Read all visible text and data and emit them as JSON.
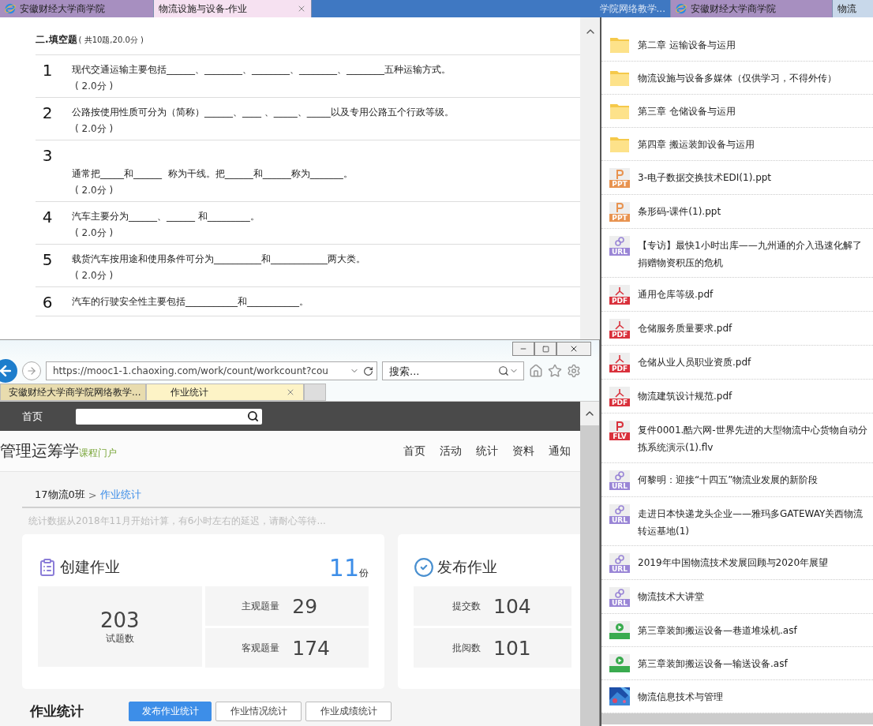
{
  "taskbar": {
    "tabs": [
      {
        "label": "安徽财经大学商学院",
        "selected": false,
        "kind": "ie"
      },
      {
        "label": "物流设施与设备-作业",
        "selected": true,
        "kind": "plain"
      },
      {
        "label": "学院网络教学...",
        "selected": false,
        "kind": "blurred"
      },
      {
        "label": "安徽财经大学商学院",
        "selected": false,
        "kind": "ie"
      },
      {
        "label": "物流",
        "selected": false,
        "kind": "plain"
      }
    ]
  },
  "homework": {
    "section_title": "二.填空题",
    "section_note": "( 共10题,20.0分 )",
    "questions": [
      {
        "number": "1",
        "kind": "inline",
        "text": "现代交通运输主要包括______、________、________、________、________五种运输方式。",
        "score": "( 2.0分 )"
      },
      {
        "number": "2",
        "kind": "inline",
        "text": "公路按使用性质可分为（简称）______、____ 、_____、_____以及专用公路五个行政等级。",
        "score": "( 2.0分 )"
      },
      {
        "number": "3",
        "kind": "block",
        "text": "通常把_____和______  称为干线。把______和______称为_______。",
        "score": "( 2.0分 )"
      },
      {
        "number": "4",
        "kind": "inline",
        "text": "汽车主要分为______、______ 和_________。",
        "score": "( 2.0分 )"
      },
      {
        "number": "5",
        "kind": "inline",
        "text": "载货汽车按用途和使用条件可分为__________和____________两大类。",
        "score": "( 2.0分 )"
      },
      {
        "number": "6",
        "kind": "inline",
        "text": "汽车的行驶安全性主要包括___________和___________。"
      }
    ]
  },
  "browser": {
    "address": "https://mooc1-1.chaoxing.com/work/count/workcount?cou",
    "search": {
      "placeholder": "搜索..."
    },
    "tabs": [
      {
        "label": "安徽财经大学商学院网络教学...",
        "selected": false
      },
      {
        "label": "作业统计",
        "selected": true
      }
    ]
  },
  "site": {
    "top_nav": "首页",
    "course_title": "管理运筹学",
    "course_subtitle": "课程门户",
    "nav": [
      "首页",
      "活动",
      "统计",
      "资料",
      "通知"
    ],
    "breadcrumb": {
      "parent": "17物流0班",
      "separator": ">",
      "current": "作业统计"
    },
    "notice": "统计数据从2018年11月开始计算，有6小时左右的延迟，请耐心等待...",
    "create_card": {
      "title": "创建作业",
      "count": "11",
      "unit": "份",
      "total": {
        "value": "203",
        "label": "试题数"
      },
      "stats": [
        {
          "label": "主观题量",
          "value": "29"
        },
        {
          "label": "客观题量",
          "value": "174"
        }
      ]
    },
    "publish_card": {
      "title": "发布作业",
      "stats": [
        {
          "label": "提交数",
          "value": "104"
        },
        {
          "label": "批阅数",
          "value": "101"
        }
      ]
    },
    "stats_heading": "作业统计",
    "stats_tabs": [
      {
        "label": "发布作业统计",
        "selected": true
      },
      {
        "label": "作业情况统计",
        "selected": false
      },
      {
        "label": "作业成绩统计",
        "selected": false
      }
    ]
  },
  "files": [
    {
      "kind": "folder",
      "name": "第二章 运输设备与运用"
    },
    {
      "kind": "folder",
      "name": "物流设施与设备多媒体（仅供学习，不得外传）"
    },
    {
      "kind": "folder",
      "name": "第三章 仓储设备与运用"
    },
    {
      "kind": "folder",
      "name": "第四章 搬运装卸设备与运用"
    },
    {
      "kind": "ppt",
      "badge": "PPT",
      "name": "3-电子数据交换技术EDI(1).ppt"
    },
    {
      "kind": "ppt",
      "badge": "PPT",
      "name": "条形码-课件(1).ppt"
    },
    {
      "kind": "url",
      "badge": "URL",
      "name": "【专访】最快1小时出库——九州通的介入迅速化解了捐赠物资积压的危机"
    },
    {
      "kind": "pdf",
      "badge": "PDF",
      "name": "通用仓库等级.pdf"
    },
    {
      "kind": "pdf",
      "badge": "PDF",
      "name": "仓储服务质量要求.pdf"
    },
    {
      "kind": "pdf",
      "badge": "PDF",
      "name": "仓储从业人员职业资质.pdf"
    },
    {
      "kind": "pdf",
      "badge": "PDF",
      "name": "物流建筑设计规范.pdf"
    },
    {
      "kind": "flv",
      "badge": "FLV",
      "name": "复件0001.酷六网-世界先进的大型物流中心货物自动分拣系统演示(1).flv"
    },
    {
      "kind": "url",
      "badge": "URL",
      "name": "何黎明：迎接“十四五”物流业发展的新阶段"
    },
    {
      "kind": "url",
      "badge": "URL",
      "name": "走进日本快递龙头企业——雅玛多GATEWAY关西物流转运基地(1)"
    },
    {
      "kind": "url",
      "badge": "URL",
      "name": "2019年中国物流技术发展回顾与2020年展望"
    },
    {
      "kind": "url",
      "badge": "URL",
      "name": "物流技术大讲堂"
    },
    {
      "kind": "video",
      "name": "第三章装卸搬运设备—巷道堆垛机.asf"
    },
    {
      "kind": "video",
      "name": "第三章装卸搬运设备—输送设备.asf"
    },
    {
      "name": "物流信息技术与管理"
    }
  ]
}
